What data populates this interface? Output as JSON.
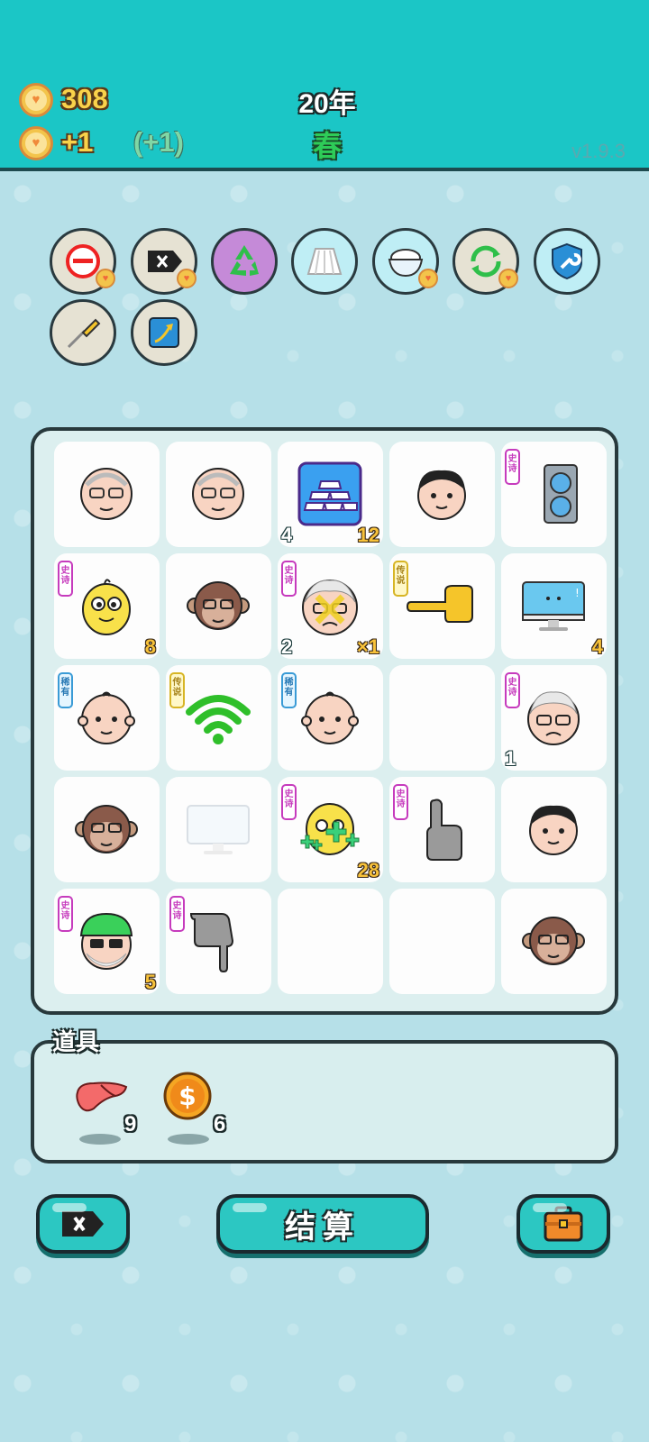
{
  "header": {
    "coins": "308",
    "income": "+1",
    "income_bonus": "(+1)",
    "year": "20年",
    "season": "春",
    "version": "v1.9.3"
  },
  "toolbar": [
    {
      "icon": "remove-icon",
      "style": "grey",
      "badge": true
    },
    {
      "icon": "delete-tag-icon",
      "style": "grey",
      "badge": true
    },
    {
      "icon": "recycle-icon",
      "style": "purple",
      "badge": false
    },
    {
      "icon": "skirt-icon",
      "style": "blue",
      "badge": false
    },
    {
      "icon": "rice-bowl-icon",
      "style": "blue",
      "badge": true
    },
    {
      "icon": "refresh-icon",
      "style": "grey",
      "badge": true
    },
    {
      "icon": "shield-wrench-icon",
      "style": "blue",
      "badge": false
    },
    {
      "icon": "screwdriver-icon",
      "style": "grey",
      "badge": false
    },
    {
      "icon": "upgrade-arrow-icon",
      "style": "grey",
      "badge": false
    }
  ],
  "rarity_labels": {
    "epic": "史诗",
    "legend": "传说",
    "rare": "稀有"
  },
  "board": [
    {
      "icon": "old-man-glasses-icon",
      "tag": "",
      "bl": "",
      "br": ""
    },
    {
      "icon": "old-man-glasses-icon",
      "tag": "",
      "bl": "",
      "br": ""
    },
    {
      "icon": "gold-bars-icon",
      "tag": "",
      "bl": "4",
      "br": "12"
    },
    {
      "icon": "young-man-icon",
      "tag": "",
      "bl": "",
      "br": ""
    },
    {
      "icon": "graphics-card-icon",
      "tag": "epic",
      "bl": "",
      "br": ""
    },
    {
      "icon": "yellow-bird-icon",
      "tag": "epic",
      "bl": "",
      "br": "8"
    },
    {
      "icon": "monkey-glasses-icon",
      "tag": "",
      "bl": "",
      "br": ""
    },
    {
      "icon": "grandpa-angry-icon",
      "tag": "epic",
      "bl": "2",
      "br": "×1"
    },
    {
      "icon": "yellow-pointing-hand-icon",
      "tag": "legend",
      "bl": "",
      "br": ""
    },
    {
      "icon": "monitor-icon",
      "tag": "",
      "bl": "",
      "br": "4"
    },
    {
      "icon": "bald-man-icon",
      "tag": "rare",
      "bl": "",
      "br": ""
    },
    {
      "icon": "wifi-icon",
      "tag": "legend",
      "bl": "",
      "br": ""
    },
    {
      "icon": "bald-man-icon",
      "tag": "rare",
      "bl": "",
      "br": ""
    },
    {
      "icon": "empty",
      "tag": "",
      "bl": "",
      "br": ""
    },
    {
      "icon": "grandpa-sad-icon",
      "tag": "epic",
      "bl": "1",
      "br": ""
    },
    {
      "icon": "monkey-glasses-icon",
      "tag": "",
      "bl": "",
      "br": ""
    },
    {
      "icon": "faded-monitor-icon",
      "tag": "",
      "bl": "",
      "br": ""
    },
    {
      "icon": "yellow-bird-healing-icon",
      "tag": "epic",
      "bl": "",
      "br": "28"
    },
    {
      "icon": "pointing-up-hand-icon",
      "tag": "epic",
      "bl": "",
      "br": ""
    },
    {
      "icon": "young-man-icon",
      "tag": "",
      "bl": "",
      "br": ""
    },
    {
      "icon": "old-man-green-hat-icon",
      "tag": "epic",
      "bl": "",
      "br": "5"
    },
    {
      "icon": "pointing-down-hand-icon",
      "tag": "epic",
      "bl": "",
      "br": ""
    },
    {
      "icon": "empty",
      "tag": "",
      "bl": "",
      "br": ""
    },
    {
      "icon": "empty",
      "tag": "",
      "bl": "",
      "br": ""
    },
    {
      "icon": "monkey-glasses-icon",
      "tag": "",
      "bl": "",
      "br": ""
    }
  ],
  "items": {
    "label": "道具",
    "list": [
      {
        "icon": "liver-icon",
        "count": "9"
      },
      {
        "icon": "dollar-coin-icon",
        "count": "6"
      }
    ]
  },
  "bottom": {
    "settle_label": "结算"
  },
  "colors": {
    "header": "#1bc6c6",
    "background": "#b6e0e8",
    "button": "#2cc7c2",
    "epic": "#c63bbd",
    "legend": "#d7b525",
    "rare": "#3a9bd6"
  }
}
